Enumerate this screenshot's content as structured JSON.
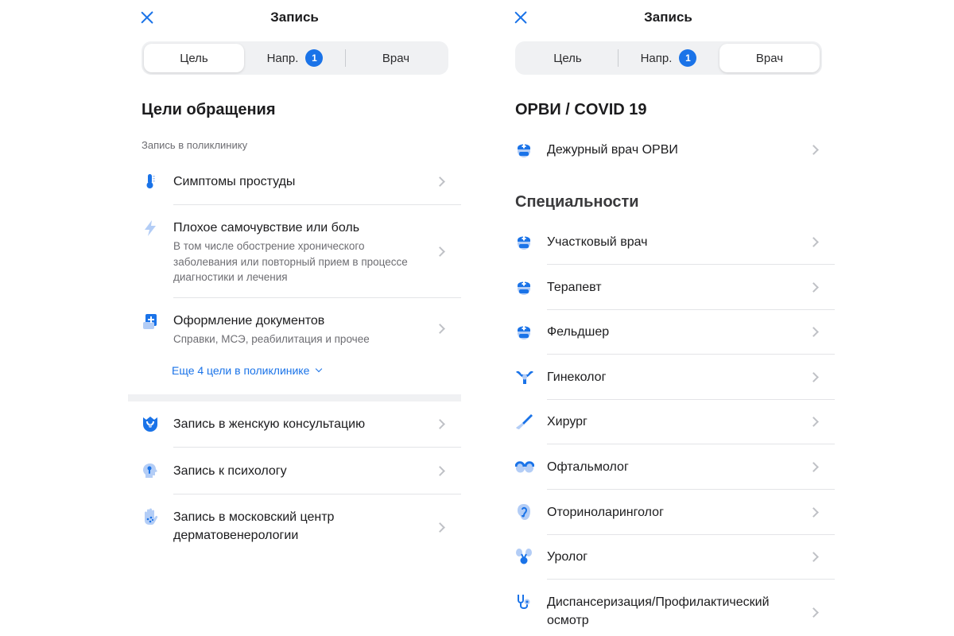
{
  "left": {
    "title": "Запись",
    "tabs": [
      {
        "label": "Цель",
        "active": true
      },
      {
        "label": "Напр.",
        "badge": "1",
        "active": false
      },
      {
        "label": "Врач",
        "active": false
      }
    ],
    "heading": "Цели обращения",
    "subheading": "Запись в поликлинику",
    "goals": [
      {
        "label": "Симптомы простуды",
        "icon": "thermometer-icon"
      },
      {
        "label": "Плохое самочувствие или боль",
        "desc": "В том числе обострение хронического заболевания или повторный прием в процессе диагностики и лечения",
        "icon": "lightning-icon"
      },
      {
        "label": "Оформление документов",
        "desc": "Справки, МСЭ, реабилитация и прочее",
        "icon": "document-plus-icon"
      }
    ],
    "more_link": "Еще 4 цели в поликлинике",
    "extra": [
      {
        "label": "Запись в женскую консультацию",
        "icon": "womens-clinic-icon"
      },
      {
        "label": "Запись к психологу",
        "icon": "psychologist-icon"
      },
      {
        "label": "Запись в московский центр дерматовенерологии",
        "icon": "hand-dots-icon"
      }
    ]
  },
  "right": {
    "title": "Запись",
    "tabs": [
      {
        "label": "Цель",
        "active": false
      },
      {
        "label": "Напр.",
        "badge": "1",
        "active": false
      },
      {
        "label": "Врач",
        "active": true
      }
    ],
    "covid_heading": "ОРВИ / COVID 19",
    "covid_items": [
      {
        "label": "Дежурный врач ОРВИ",
        "icon": "doctor-icon"
      }
    ],
    "specialties_heading": "Специальности",
    "specialties": [
      {
        "label": "Участковый врач",
        "icon": "doctor-icon"
      },
      {
        "label": "Терапевт",
        "icon": "doctor-icon"
      },
      {
        "label": "Фельдшер",
        "icon": "doctor-icon"
      },
      {
        "label": "Гинеколог",
        "icon": "uterus-icon"
      },
      {
        "label": "Хирург",
        "icon": "scalpel-icon"
      },
      {
        "label": "Офтальмолог",
        "icon": "eyes-icon"
      },
      {
        "label": "Оториноларинголог",
        "icon": "ear-icon"
      },
      {
        "label": "Уролог",
        "icon": "kidneys-icon"
      },
      {
        "label": "Диспансеризация/Профилактический осмотр",
        "icon": "stethoscope-icon"
      }
    ]
  },
  "colors": {
    "accent": "#1a73e8",
    "icon_light": "#b3cdf6",
    "chevron": "#bfc1c6",
    "separator": "#e3e4e7",
    "segment_bg": "#f0f1f3"
  }
}
